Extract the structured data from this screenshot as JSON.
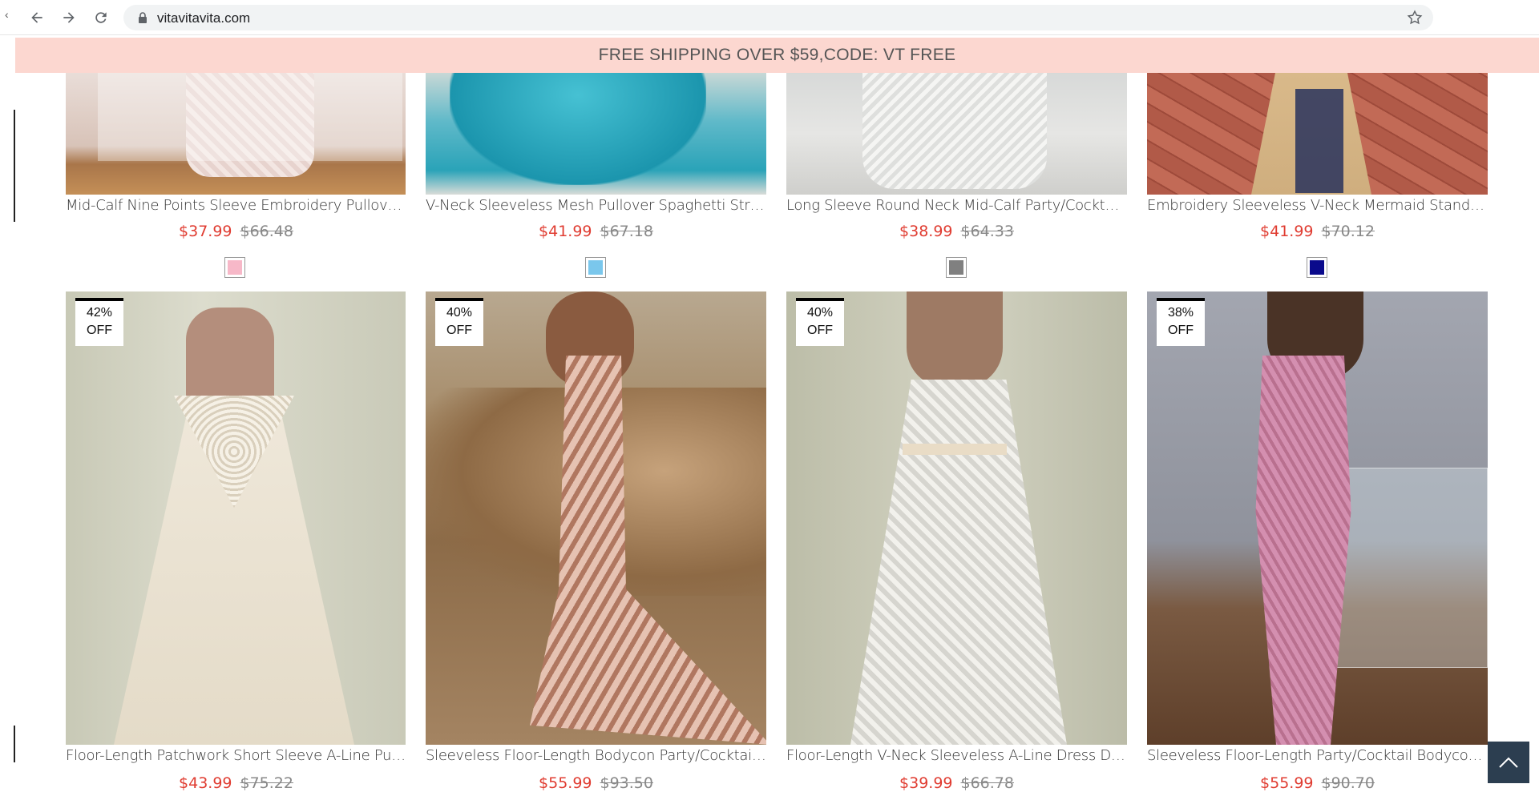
{
  "browser": {
    "url": "vitavitavita.com",
    "icons": [
      "back-arrow-icon",
      "forward-arrow-icon",
      "reload-icon",
      "lock-icon",
      "bookmark-star-icon"
    ]
  },
  "banner": {
    "text": "FREE SHIPPING OVER $59,CODE: VT FREE",
    "color": "#fcd7d0"
  },
  "colors": {
    "price": "#e03c31",
    "old_price": "#888888",
    "badge_text": "#111111"
  },
  "row1": [
    {
      "title": "Mid-Calf Nine Points Sleeve Embroidery Pullover Part...",
      "price": "$37.99",
      "old_price": "$66.48",
      "swatch": "#f7b8c8"
    },
    {
      "title": "V-Neck Sleeveless Mesh Pullover Spaghetti Strap Dress",
      "price": "$41.99",
      "old_price": "$67.18",
      "swatch": "#7ac7ec"
    },
    {
      "title": "Long Sleeve Round Neck Mid-Calf Party/Cocktail Re...",
      "price": "$38.99",
      "old_price": "$64.33",
      "swatch": "#808080"
    },
    {
      "title": "Embroidery Sleeveless V-Neck Mermaid Standard-W...",
      "price": "$41.99",
      "old_price": "$70.12",
      "swatch": "#0a0a8c"
    }
  ],
  "row2": [
    {
      "badge_pct": "42%",
      "badge_off": "OFF",
      "title": "Floor-Length Patchwork Short Sleeve A-Line Pullover D...",
      "price": "$43.99",
      "old_price": "$75.22"
    },
    {
      "badge_pct": "40%",
      "badge_off": "OFF",
      "title": "Sleeveless Floor-Length Bodycon Party/Cocktail Dress",
      "price": "$55.99",
      "old_price": "$93.50"
    },
    {
      "badge_pct": "40%",
      "badge_off": "OFF",
      "title": "Floor-Length V-Neck Sleeveless A-Line Dress Dress",
      "price": "$39.99",
      "old_price": "$66.78"
    },
    {
      "badge_pct": "38%",
      "badge_off": "OFF",
      "title": "Sleeveless Floor-Length Party/Cocktail Bodycon Dress",
      "price": "$55.99",
      "old_price": "$90.70"
    }
  ]
}
